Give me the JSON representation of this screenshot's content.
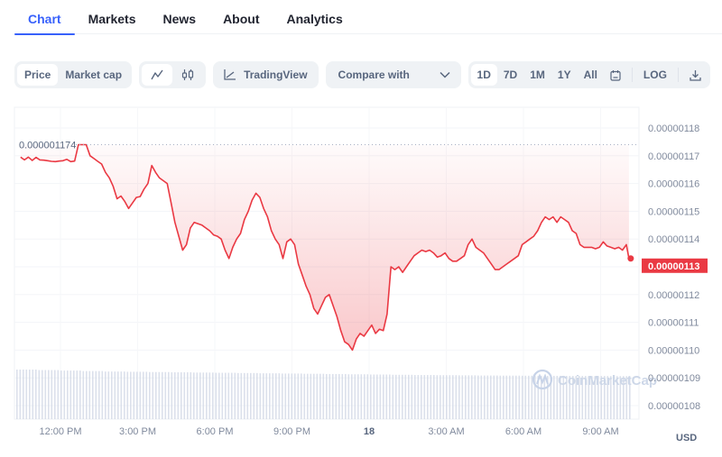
{
  "tabs": [
    {
      "label": "Chart",
      "active": true
    },
    {
      "label": "Markets",
      "active": false
    },
    {
      "label": "News",
      "active": false
    },
    {
      "label": "About",
      "active": false
    },
    {
      "label": "Analytics",
      "active": false
    }
  ],
  "toolbar": {
    "metric_options": [
      {
        "label": "Price",
        "active": true
      },
      {
        "label": "Market cap",
        "active": false
      }
    ],
    "chart_types": [
      {
        "icon": "line-chart-icon",
        "active": true
      },
      {
        "icon": "candlestick-icon",
        "active": false
      }
    ],
    "tradingview_label": "TradingView",
    "compare_label": "Compare with",
    "ranges": [
      {
        "label": "1D",
        "active": true
      },
      {
        "label": "7D",
        "active": false
      },
      {
        "label": "1M",
        "active": false
      },
      {
        "label": "1Y",
        "active": false
      },
      {
        "label": "All",
        "active": false
      }
    ],
    "log_label": "LOG"
  },
  "currency_label": "USD",
  "watermark": "CoinMarketCap",
  "colors": {
    "accent": "#3861fb",
    "line": "#ea3943",
    "volume": "#cfd6e4"
  },
  "chart_data": {
    "type": "line",
    "title": "",
    "xlabel": "",
    "ylabel": "",
    "currency": "USD",
    "ylim": [
      1.075e-06,
      1.193e-06
    ],
    "yticks": [
      "0.00000118",
      "0.00000117",
      "0.00000116",
      "0.00000115",
      "0.00000114",
      "0.00000113",
      "0.00000112",
      "0.00000111",
      "0.00000110",
      "0.00000109",
      "0.00000108"
    ],
    "ytick_values": [
      1.18e-06,
      1.17e-06,
      1.16e-06,
      1.15e-06,
      1.14e-06,
      1.13e-06,
      1.12e-06,
      1.11e-06,
      1.1e-06,
      1.09e-06,
      1.08e-06
    ],
    "xticks": [
      {
        "label": "12:00 PM",
        "hour": 12
      },
      {
        "label": "3:00 PM",
        "hour": 15
      },
      {
        "label": "6:00 PM",
        "hour": 18
      },
      {
        "label": "9:00 PM",
        "hour": 21
      },
      {
        "label": "18",
        "hour": 24,
        "bold": true
      },
      {
        "label": "3:00 AM",
        "hour": 27
      },
      {
        "label": "6:00 AM",
        "hour": 30
      },
      {
        "label": "9:00 AM",
        "hour": 33
      }
    ],
    "xlim_hours": [
      10.4,
      34.2
    ],
    "open_price_label": "0.000001174",
    "open_price": 1.174e-06,
    "current_price_label": "0.00000113",
    "current_price": 1.1304e-06,
    "series": [
      {
        "name": "Price",
        "points_hours": [
          10.45,
          10.6,
          10.75,
          10.9,
          11.05,
          11.2,
          11.35,
          11.5,
          11.65,
          11.8,
          11.95,
          12.1,
          12.25,
          12.4,
          12.55,
          12.7,
          12.85,
          13.0,
          13.15,
          13.3,
          13.45,
          13.6,
          13.75,
          13.9,
          14.05,
          14.2,
          14.35,
          14.5,
          14.65,
          14.8,
          14.95,
          15.1,
          15.25,
          15.4,
          15.55,
          15.7,
          15.85,
          16.0,
          16.15,
          16.3,
          16.45,
          16.6,
          16.75,
          16.9,
          17.05,
          17.2,
          17.35,
          17.5,
          17.65,
          17.8,
          17.95,
          18.1,
          18.25,
          18.4,
          18.55,
          18.7,
          18.85,
          19.0,
          19.15,
          19.3,
          19.45,
          19.6,
          19.75,
          19.9,
          20.05,
          20.2,
          20.35,
          20.5,
          20.65,
          20.8,
          20.95,
          21.1,
          21.25,
          21.4,
          21.55,
          21.7,
          21.85,
          22.0,
          22.15,
          22.3,
          22.45,
          22.6,
          22.75,
          22.9,
          23.05,
          23.2,
          23.35,
          23.5,
          23.65,
          23.8,
          23.95,
          24.1,
          24.25,
          24.4,
          24.55,
          24.7,
          24.85,
          25.0,
          25.15,
          25.3,
          25.45,
          25.6,
          25.75,
          25.9,
          26.05,
          26.2,
          26.35,
          26.5,
          26.65,
          26.8,
          26.95,
          27.1,
          27.25,
          27.4,
          27.55,
          27.7,
          27.85,
          28.0,
          28.15,
          28.3,
          28.45,
          28.6,
          28.75,
          28.9,
          29.05,
          29.2,
          29.35,
          29.5,
          29.65,
          29.8,
          29.95,
          30.1,
          30.25,
          30.4,
          30.55,
          30.7,
          30.85,
          31.0,
          31.15,
          31.3,
          31.45,
          31.6,
          31.75,
          31.9,
          32.05,
          32.2,
          32.35,
          32.5,
          32.65,
          32.8,
          32.95,
          33.1,
          33.25,
          33.4,
          33.55,
          33.7,
          33.85,
          34.0,
          34.1
        ],
        "values": [
          1.1695,
          1.1685,
          1.1695,
          1.1683,
          1.1694,
          1.1685,
          1.1684,
          1.1682,
          1.168,
          1.1679,
          1.1681,
          1.1682,
          1.1687,
          1.1679,
          1.1681,
          1.174,
          1.174,
          1.174,
          1.17,
          1.169,
          1.168,
          1.167,
          1.164,
          1.162,
          1.159,
          1.1545,
          1.1555,
          1.1535,
          1.151,
          1.153,
          1.155,
          1.1553,
          1.158,
          1.16,
          1.1665,
          1.164,
          1.162,
          1.161,
          1.16,
          1.153,
          1.146,
          1.141,
          1.136,
          1.138,
          1.144,
          1.146,
          1.1455,
          1.145,
          1.144,
          1.143,
          1.1415,
          1.141,
          1.14,
          1.136,
          1.133,
          1.137,
          1.14,
          1.142,
          1.147,
          1.15,
          1.154,
          1.1565,
          1.155,
          1.151,
          1.148,
          1.143,
          1.14,
          1.138,
          1.133,
          1.139,
          1.14,
          1.138,
          1.131,
          1.127,
          1.123,
          1.12,
          1.115,
          1.113,
          1.116,
          1.119,
          1.12,
          1.116,
          1.112,
          1.107,
          1.103,
          1.102,
          1.1,
          1.104,
          1.106,
          1.105,
          1.107,
          1.109,
          1.106,
          1.1075,
          1.107,
          1.113,
          1.13,
          1.129,
          1.13,
          1.128,
          1.13,
          1.132,
          1.134,
          1.135,
          1.136,
          1.1355,
          1.136,
          1.135,
          1.1335,
          1.134,
          1.135,
          1.133,
          1.132,
          1.132,
          1.133,
          1.134,
          1.138,
          1.14,
          1.137,
          1.136,
          1.135,
          1.133,
          1.131,
          1.129,
          1.129,
          1.13,
          1.131,
          1.132,
          1.133,
          1.134,
          1.138,
          1.139,
          1.14,
          1.141,
          1.143,
          1.146,
          1.148,
          1.147,
          1.148,
          1.146,
          1.148,
          1.147,
          1.146,
          1.143,
          1.142,
          1.138,
          1.137,
          1.137,
          1.137,
          1.1365,
          1.137,
          1.139,
          1.1375,
          1.137,
          1.1365,
          1.137,
          1.136,
          1.138,
          1.133,
          1.131,
          1.1305,
          1.129,
          1.128,
          1.133,
          1.1337,
          1.1304
        ],
        "value_scale": 1e-06
      }
    ],
    "volume": {
      "name": "Volume",
      "description": "24h volume histogram (relative, decreasing across the day)",
      "relative_values": [
        1.0,
        0.99,
        0.98,
        0.97,
        0.96,
        0.955,
        0.95,
        0.945,
        0.94,
        0.935,
        0.93,
        0.925,
        0.92,
        0.915,
        0.91,
        0.905,
        0.9,
        0.895,
        0.89,
        0.887,
        0.884,
        0.88,
        0.878,
        0.876,
        0.874,
        0.872,
        0.87,
        0.868
      ]
    },
    "grid": true,
    "legend": "none"
  }
}
